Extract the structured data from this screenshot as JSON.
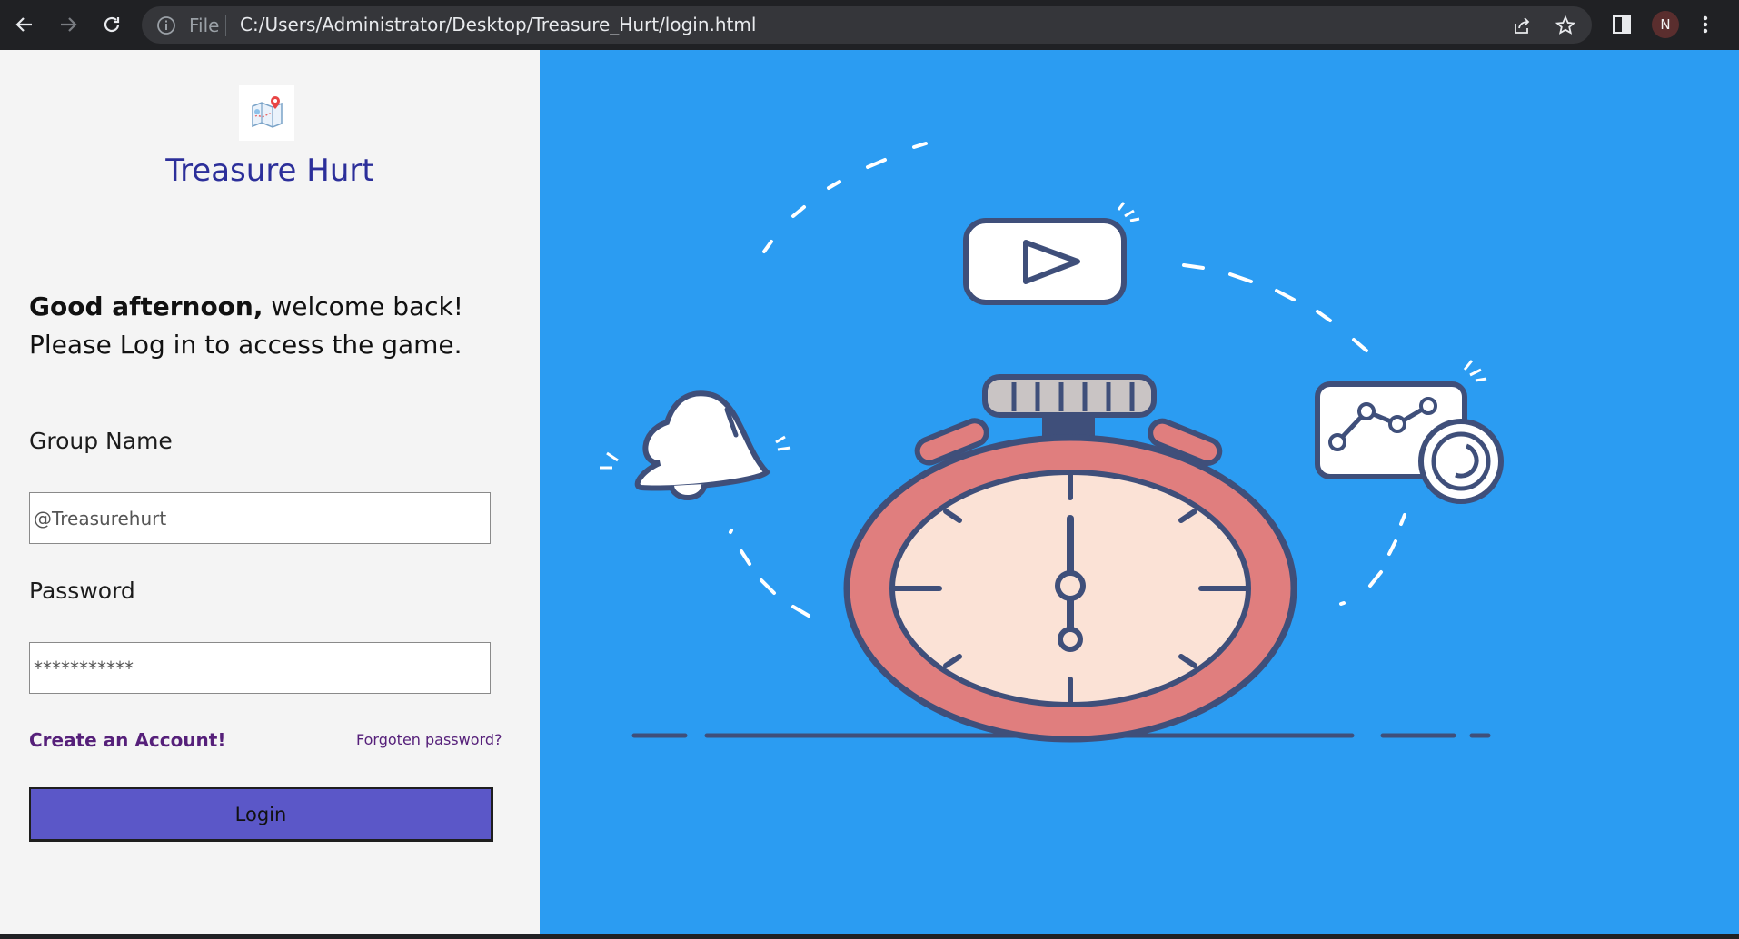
{
  "browser": {
    "file_label": "File",
    "url": "C:/Users/Administrator/Desktop/Treasure_Hurt/login.html",
    "profile_initial": "N"
  },
  "brand": {
    "title": "Treasure Hurt"
  },
  "greeting": {
    "bold": "Good afternoon,",
    "rest": " welcome back!",
    "line2": "Please Log in to access the game."
  },
  "form": {
    "group_label": "Group Name",
    "group_value": "@Treasurehurt",
    "password_label": "Password",
    "password_value": "***********",
    "create_account": "Create an Account!",
    "forgot_password": "Forgoten password?",
    "login_button": "Login"
  },
  "colors": {
    "brand": "#2c2f9a",
    "hero_bg": "#2b9cf2",
    "button": "#5b57c8",
    "link": "#56207a"
  }
}
